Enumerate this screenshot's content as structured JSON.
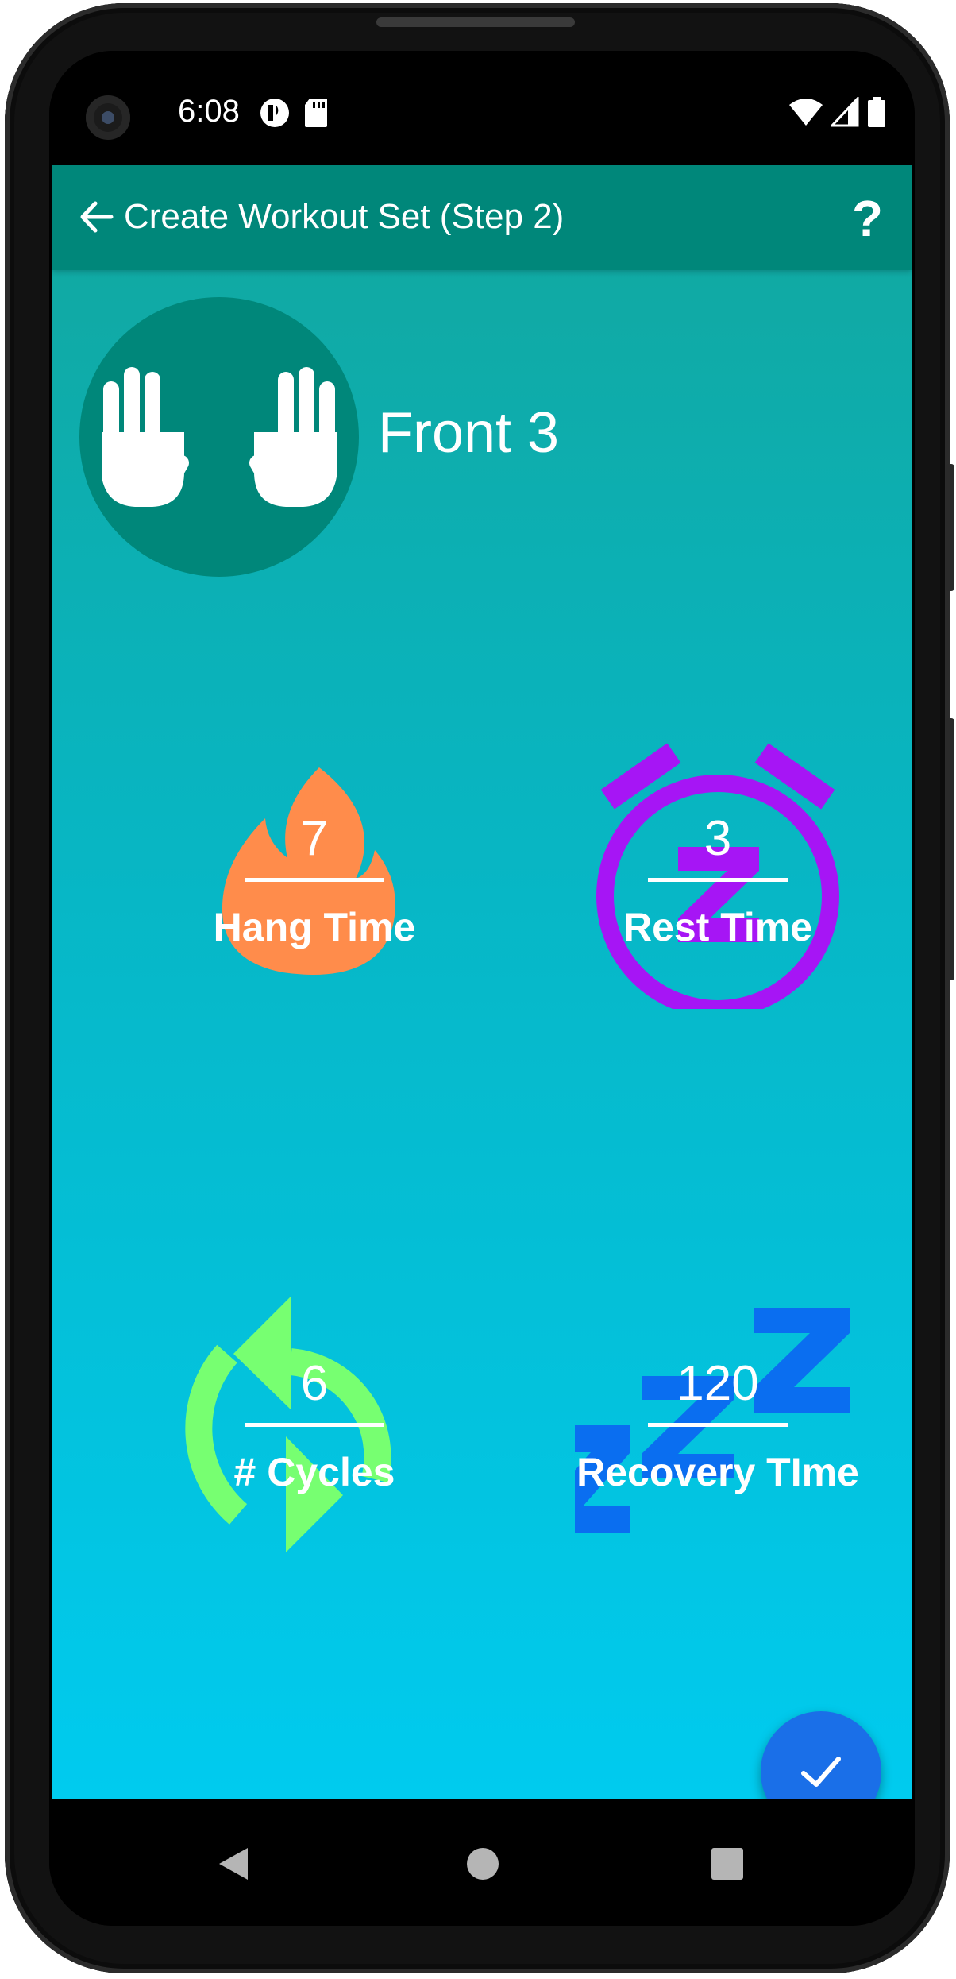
{
  "status_bar": {
    "time": "6:08"
  },
  "toolbar": {
    "title": "Create Workout Set (Step 2)",
    "help_label": "?"
  },
  "hold": {
    "name": "Front 3"
  },
  "stats": {
    "hang_time": {
      "value": "7",
      "label": "Hang Time",
      "icon": "flame-icon",
      "color": "#ff8c4b"
    },
    "rest_time": {
      "value": "3",
      "label": "Rest Time",
      "icon": "alarm-clock-icon",
      "color": "#a615f5"
    },
    "cycles": {
      "value": "6",
      "label": "# Cycles",
      "icon": "repeat-icon",
      "color": "#77ff71"
    },
    "recovery_time": {
      "value": "120",
      "label": "Recovery TIme",
      "icon": "sleep-zzz-icon",
      "color": "#0a6ef0"
    }
  },
  "colors": {
    "toolbar": "#00877a",
    "fab": "#1a6fe8",
    "background_top": "#12a79e",
    "background_bottom": "#00cbef"
  },
  "fab": {
    "icon": "check-icon"
  },
  "nav": {
    "icons": [
      "back-triangle-icon",
      "home-circle-icon",
      "recents-square-icon"
    ]
  }
}
